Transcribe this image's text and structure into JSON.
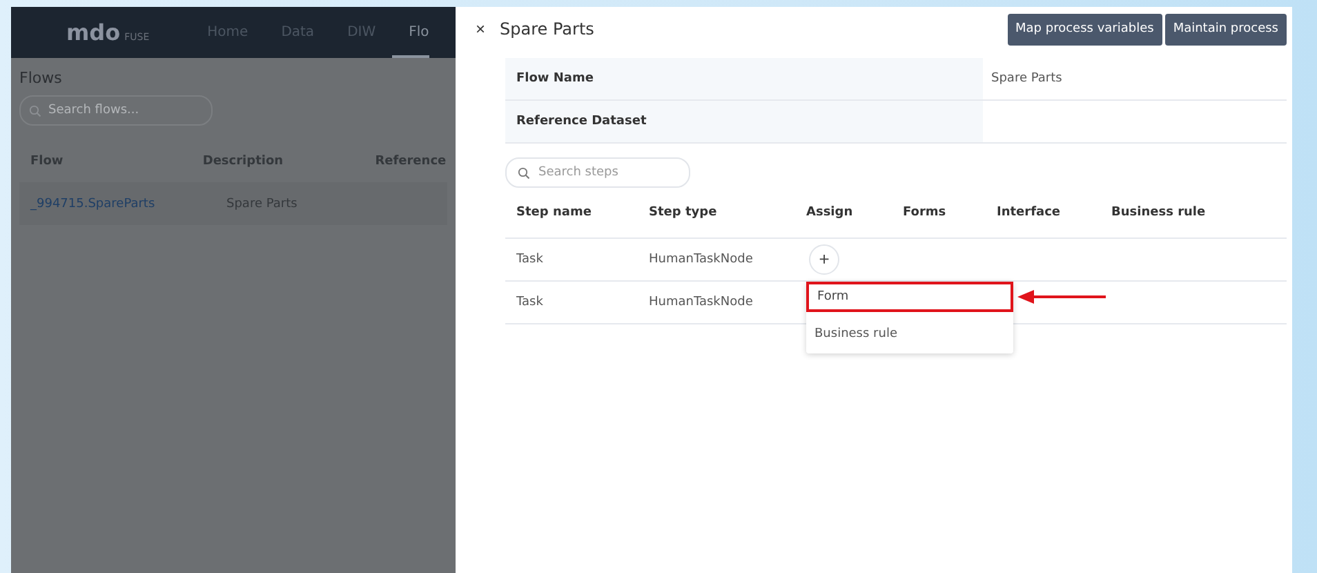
{
  "background_app": {
    "nav": {
      "logo": "mdo",
      "logo_suffix": "FUSE",
      "items": [
        {
          "label": "Home",
          "selected": false
        },
        {
          "label": "Data",
          "selected": false
        },
        {
          "label": "DIW",
          "selected": false
        },
        {
          "label": "Flo",
          "selected": true
        }
      ]
    },
    "title": "Flows",
    "search": {
      "placeholder": "Search flows..."
    },
    "table": {
      "columns": [
        "Flow",
        "Description",
        "Reference"
      ],
      "rows": [
        [
          "_994715.SpareParts",
          "Spare Parts"
        ]
      ]
    }
  },
  "drawer": {
    "close": "×",
    "title": "Spare Parts",
    "buttons": [
      "Map process variables",
      "Maintain process"
    ],
    "details": [
      {
        "label": "Flow Name",
        "value": "Spare Parts"
      },
      {
        "label": "Reference Dataset"
      }
    ],
    "search": {
      "placeholder": "Search steps"
    },
    "steps": {
      "columns": [
        "Step name",
        "Step type",
        "Assign",
        "Forms",
        "Interface",
        "Business rule"
      ],
      "rows": [
        {
          "name": "Task",
          "type": "HumanTaskNode",
          "assign": "+",
          "menu_open": false
        },
        {
          "name": "Task",
          "type": "HumanTaskNode",
          "menu_open": true
        }
      ]
    },
    "menu": {
      "items": [
        {
          "label": "Form",
          "highlighted": true
        },
        {
          "label": "Business rule",
          "highlighted": false
        }
      ]
    }
  }
}
